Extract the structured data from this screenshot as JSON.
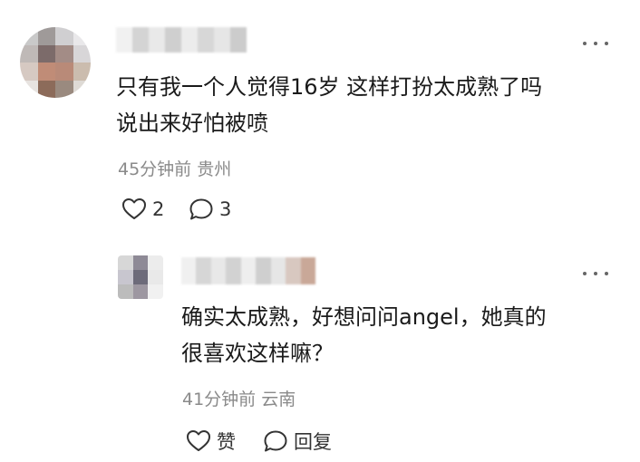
{
  "comment": {
    "avatar_colors": [
      "#c9c9c9",
      "#9f9a99",
      "#d0cfd1",
      "#e9e8ea",
      "#bfb9b7",
      "#7c6b6a",
      "#a38c86",
      "#d8d6d8",
      "#d6c9c2",
      "#c08c77",
      "#b98a78",
      "#cbbcae",
      "#e7e3e0",
      "#8c6b5a",
      "#9a8a7f",
      "#dedad5"
    ],
    "username_colors": [
      "#f1f1f1",
      "#d4d4d4",
      "#e9e9e9",
      "#cfcfcf",
      "#ececec",
      "#d7d7d7",
      "#e6e6e6",
      "#cccccc"
    ],
    "text_line1": "只有我一个人觉得16岁 这样打扮太成熟了吗",
    "text_line2": "说出来好怕被喷",
    "meta": "45分钟前 贵州",
    "like_count": "2",
    "comment_count": "3"
  },
  "reply": {
    "avatar_colors": [
      "#d7d7d7",
      "#8e8a96",
      "#ececec",
      "#c8c6cf",
      "#6d6b7a",
      "#e9e9e9",
      "#bcbcbc",
      "#9d97a1",
      "#f1f1f1"
    ],
    "username_colors": [
      "#f0f0f0",
      "#d6d6d6",
      "#e8e8e8",
      "#d2d2d2",
      "#eeeeee",
      "#cfcfcf",
      "#e6e6e6",
      "#d8c8c0",
      "#c9a898"
    ],
    "text_line1": "确实太成熟，好想问问angel，她真的",
    "text_line2": "很喜欢这样嘛？",
    "meta": "41分钟前 云南",
    "like_label": "赞",
    "reply_label": "回复"
  }
}
